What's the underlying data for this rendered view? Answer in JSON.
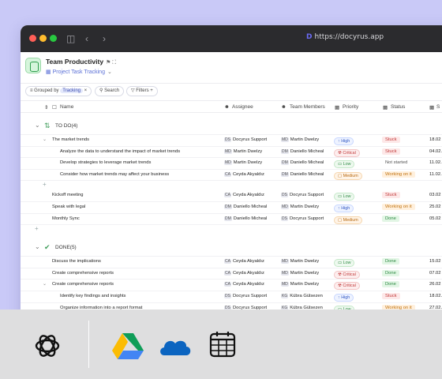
{
  "browser": {
    "url": "https://docyrus.app"
  },
  "app": {
    "title": "Team Productivity",
    "view": "Project Task Tracking"
  },
  "toolbar": {
    "grouped_by_label": "Grouped by",
    "grouped_by_value": "Tracking",
    "search_label": "Search",
    "filters_label": "Filters"
  },
  "columns": {
    "name": "Name",
    "assignee": "Assignee",
    "team_members": "Team Members",
    "priority": "Priority",
    "status": "Status",
    "date": "S"
  },
  "groups": [
    {
      "title": "TO DO(4)",
      "rows": [
        {
          "name": "The market trends",
          "level": "parent",
          "assignee_initials": "DS",
          "assignee": "Docyrus Support",
          "member_initials": "MD",
          "member": "Martin Dwelzy",
          "priority": "High",
          "status": "Stuck",
          "date": "18.02"
        },
        {
          "name": "Analyze the data to understand the impact of market trends",
          "level": "sub",
          "assignee_initials": "MD",
          "assignee": "Martin Dwelzy",
          "member_initials": "DM",
          "member": "Daniello Micheal",
          "priority": "Critical",
          "status": "Stuck",
          "date": "04.02.202"
        },
        {
          "name": "Develop strategies to leverage market trends",
          "level": "sub",
          "assignee_initials": "MD",
          "assignee": "Martin Dwelzy",
          "member_initials": "DM",
          "member": "Daniello Micheal",
          "priority": "Low",
          "status": "Not started",
          "date": "11.02.202"
        },
        {
          "name": "Consider how market trends may affect your business",
          "level": "sub",
          "assignee_initials": "CA",
          "assignee": "Ceyda Akyaldız",
          "member_initials": "DM",
          "member": "Daniello Micheal",
          "priority": "Medium",
          "status": "Working on it",
          "date": "11.02.202"
        },
        {
          "name": "Kickoff meeting",
          "level": "top",
          "assignee_initials": "CA",
          "assignee": "Ceyda Akyaldız",
          "member_initials": "DS",
          "member": "Docyrus Support",
          "priority": "Low",
          "status": "Stuck",
          "date": "03.02"
        },
        {
          "name": "Speak with legal",
          "level": "top",
          "assignee_initials": "DM",
          "assignee": "Daniello Micheal",
          "member_initials": "MD",
          "member": "Martin Dwelzy",
          "priority": "High",
          "status": "Working on it",
          "date": "25.02"
        },
        {
          "name": "Monthly Sync",
          "level": "top",
          "assignee_initials": "DM",
          "assignee": "Daniello Micheal",
          "member_initials": "DS",
          "member": "Docyrus Support",
          "priority": "Medium",
          "status": "Done",
          "date": "05.02"
        }
      ]
    },
    {
      "title": "DONE(5)",
      "rows": [
        {
          "name": "Discuss the implications",
          "level": "top",
          "assignee_initials": "CA",
          "assignee": "Ceyda Akyaldız",
          "member_initials": "MD",
          "member": "Martin Dwelzy",
          "priority": "Low",
          "status": "Done",
          "date": "15.02"
        },
        {
          "name": "Create comprehensive reports",
          "level": "top",
          "assignee_initials": "CA",
          "assignee": "Ceyda Akyaldız",
          "member_initials": "MD",
          "member": "Martin Dwelzy",
          "priority": "Critical",
          "status": "Done",
          "date": "07.02"
        },
        {
          "name": "Create comprehensive reports",
          "level": "parent",
          "assignee_initials": "CA",
          "assignee": "Ceyda Akyaldız",
          "member_initials": "MD",
          "member": "Martin Dwelzy",
          "priority": "Critical",
          "status": "Done",
          "date": "26.02"
        },
        {
          "name": "Identify key findings and insights",
          "level": "sub",
          "assignee_initials": "DS",
          "assignee": "Docyrus Support",
          "member_initials": "KG",
          "member": "Kübra Gülsezen",
          "priority": "High",
          "status": "Stuck",
          "date": "18.02.202"
        },
        {
          "name": "Organize information into a report format",
          "level": "sub",
          "assignee_initials": "DS",
          "assignee": "Docyrus Support",
          "member_initials": "KG",
          "member": "Kübra Gülsezen",
          "priority": "Low",
          "status": "Working on it",
          "date": "27.02.202"
        }
      ]
    }
  ],
  "dock": {
    "apps": [
      "openai-icon",
      "google-drive-icon",
      "onedrive-icon",
      "calendar-icon"
    ]
  },
  "colors": {
    "background": "#c9c9f7",
    "accent": "#5a6fd6"
  }
}
